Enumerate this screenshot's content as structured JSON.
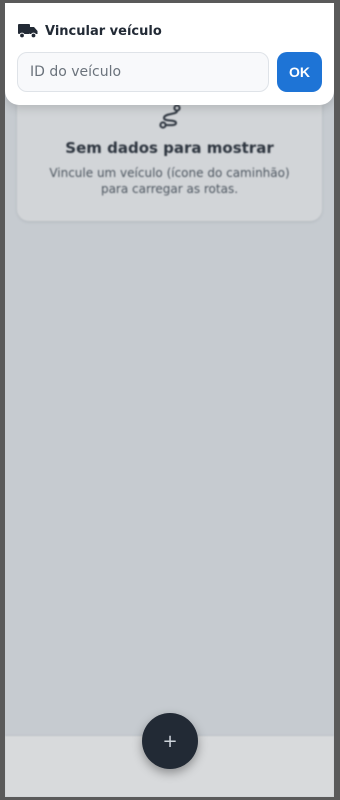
{
  "link_dialog": {
    "icon": "truck-icon",
    "title": "Vincular veículo",
    "input_placeholder": "ID do veículo",
    "input_value": "",
    "ok_label": "OK"
  },
  "empty_state": {
    "icon": "route-icon",
    "title": "Sem dados para mostrar",
    "description": "Vincule um veículo (ícone do caminhão) para carregar as rotas."
  },
  "fab": {
    "icon": "plus-icon",
    "label": "+"
  },
  "colors": {
    "accent": "#1e74d6",
    "fab": "#222a35",
    "background": "#e9edf1"
  }
}
